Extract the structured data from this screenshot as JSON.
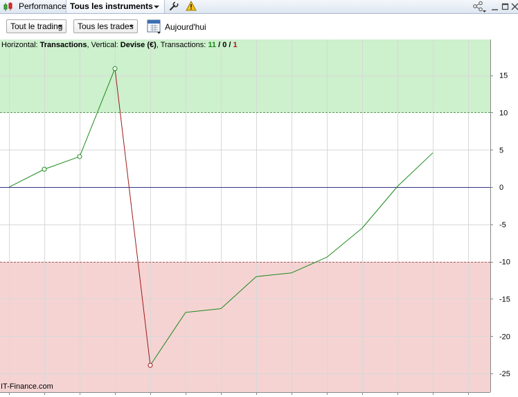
{
  "tabs": {
    "performance_label": "Performance",
    "instruments_label": "Tous les instruments"
  },
  "toolbar": {
    "trading_filter": "Tout le trading",
    "trades_filter": "Tous les trades",
    "date_label": "Aujourd'hui"
  },
  "info": {
    "horizontal_prefix": "Horizontal: ",
    "horizontal_value": "Transactions",
    "vertical_prefix": ", Vertical: ",
    "vertical_value": "Devise (€)",
    "count_prefix": ", Transactions: ",
    "count_win": "11",
    "sep1": " / ",
    "count_neutral": "0",
    "sep2": " / ",
    "count_loss": "1"
  },
  "footer": {
    "credit": "IT-Finance.com"
  },
  "colors": {
    "gain": "#1a8a1a",
    "loss": "#a01818",
    "gain_zone": "#cdf0cd",
    "loss_zone": "#f5d3d3",
    "zero_line": "#333388"
  },
  "chart_data": {
    "type": "line",
    "xlabel": "Transactions",
    "ylabel": "Devise (€)",
    "x": [
      0,
      1,
      2,
      3,
      4,
      5,
      6,
      7,
      8,
      9,
      10,
      11,
      12
    ],
    "values": [
      0,
      2.4,
      4.1,
      15.9,
      -23.9,
      -16.8,
      -16.3,
      -12.0,
      -11.5,
      -9.4,
      -5.5,
      0.1,
      4.6
    ],
    "marked_points": [
      1,
      2,
      3,
      4
    ],
    "xlim": [
      0,
      14
    ],
    "ylim": [
      -27.5,
      19.8
    ],
    "yticks": [
      15,
      10,
      5,
      0,
      -5,
      -10,
      -15,
      -20,
      -25
    ],
    "upper_threshold": 10,
    "lower_threshold": -10,
    "grid": true
  }
}
